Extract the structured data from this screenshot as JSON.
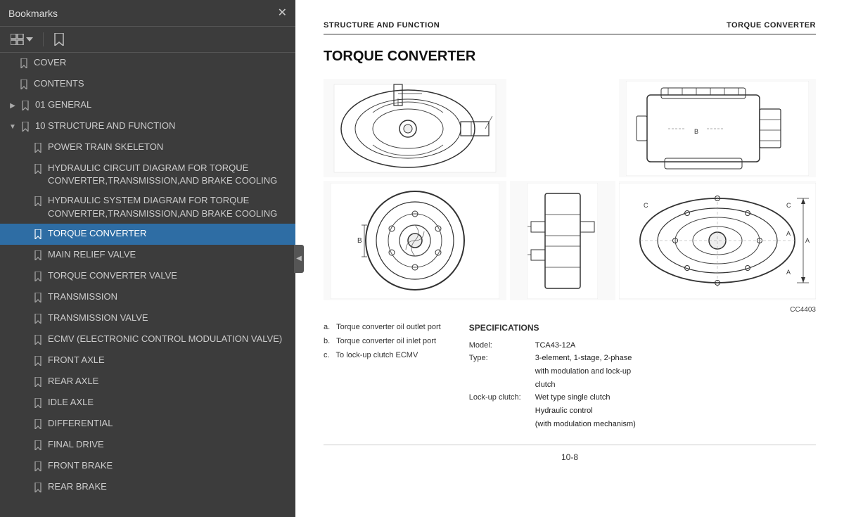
{
  "bookmarks": {
    "title": "Bookmarks",
    "close_label": "✕",
    "toolbar": {
      "view_icon": "⊞",
      "bookmark_icon": "🔖"
    },
    "items": [
      {
        "id": "cover",
        "label": "COVER",
        "level": 0,
        "expandable": false,
        "active": false
      },
      {
        "id": "contents",
        "label": "CONTENTS",
        "level": 0,
        "expandable": false,
        "active": false
      },
      {
        "id": "01general",
        "label": "01 GENERAL",
        "level": 0,
        "expandable": true,
        "expanded": false,
        "active": false
      },
      {
        "id": "10structure",
        "label": "10 STRUCTURE AND FUNCTION",
        "level": 0,
        "expandable": true,
        "expanded": true,
        "active": false
      },
      {
        "id": "power-train",
        "label": "POWER TRAIN SKELETON",
        "level": 1,
        "expandable": false,
        "active": false
      },
      {
        "id": "hydraulic-circuit",
        "label": "HYDRAULIC CIRCUIT DIAGRAM FOR TORQUE CONVERTER,TRANSMISSION,AND BRAKE COOLING",
        "level": 1,
        "expandable": false,
        "active": false
      },
      {
        "id": "hydraulic-system",
        "label": "HYDRAULIC SYSTEM DIAGRAM FOR TORQUE CONVERTER,TRANSMISSION,AND BRAKE COOLING",
        "level": 1,
        "expandable": false,
        "active": false
      },
      {
        "id": "torque-converter",
        "label": "TORQUE CONVERTER",
        "level": 1,
        "expandable": false,
        "active": true
      },
      {
        "id": "main-relief",
        "label": "MAIN RELIEF VALVE",
        "level": 1,
        "expandable": false,
        "active": false
      },
      {
        "id": "torque-converter-valve",
        "label": "TORQUE CONVERTER VALVE",
        "level": 1,
        "expandable": false,
        "active": false
      },
      {
        "id": "transmission",
        "label": "TRANSMISSION",
        "level": 1,
        "expandable": false,
        "active": false
      },
      {
        "id": "transmission-valve",
        "label": "TRANSMISSION VALVE",
        "level": 1,
        "expandable": false,
        "active": false
      },
      {
        "id": "ecmv",
        "label": "ECMV (ELECTRONIC CONTROL MODULATION VALVE)",
        "level": 1,
        "expandable": false,
        "active": false
      },
      {
        "id": "front-axle",
        "label": "FRONT AXLE",
        "level": 1,
        "expandable": false,
        "active": false
      },
      {
        "id": "rear-axle",
        "label": "REAR AXLE",
        "level": 1,
        "expandable": false,
        "active": false
      },
      {
        "id": "idle-axle",
        "label": "IDLE AXLE",
        "level": 1,
        "expandable": false,
        "active": false
      },
      {
        "id": "differential",
        "label": "DIFFERENTIAL",
        "level": 1,
        "expandable": false,
        "active": false
      },
      {
        "id": "final-drive",
        "label": "FINAL DRIVE",
        "level": 1,
        "expandable": false,
        "active": false
      },
      {
        "id": "front-brake",
        "label": "FRONT BRAKE",
        "level": 1,
        "expandable": false,
        "active": false
      },
      {
        "id": "rear-brake",
        "label": "REAR BRAKE",
        "level": 1,
        "expandable": false,
        "active": false
      }
    ]
  },
  "document": {
    "header_left": "STRUCTURE AND FUNCTION",
    "header_right": "TORQUE CONVERTER",
    "title": "TORQUE CONVERTER",
    "diagram_code": "CC4403",
    "annotations": {
      "items": [
        {
          "label": "a.",
          "text": "Torque converter oil outlet port"
        },
        {
          "label": "b.",
          "text": "Torque converter oil inlet port"
        },
        {
          "label": "c.",
          "text": "To lock-up clutch ECMV"
        }
      ]
    },
    "specifications": {
      "title": "SPECIFICATIONS",
      "rows": [
        {
          "label": "Model:",
          "value": "TCA43-12A"
        },
        {
          "label": "Type:",
          "value": "3-element, 1-stage, 2-phase\nwith modulation and lock-up\nclutch"
        },
        {
          "label": "Lock-up clutch:",
          "value": "Wet type single clutch\nHydraulic control\n(with modulation mechanism)"
        }
      ]
    },
    "page_number": "10-8"
  },
  "collapse_arrow": "◀"
}
